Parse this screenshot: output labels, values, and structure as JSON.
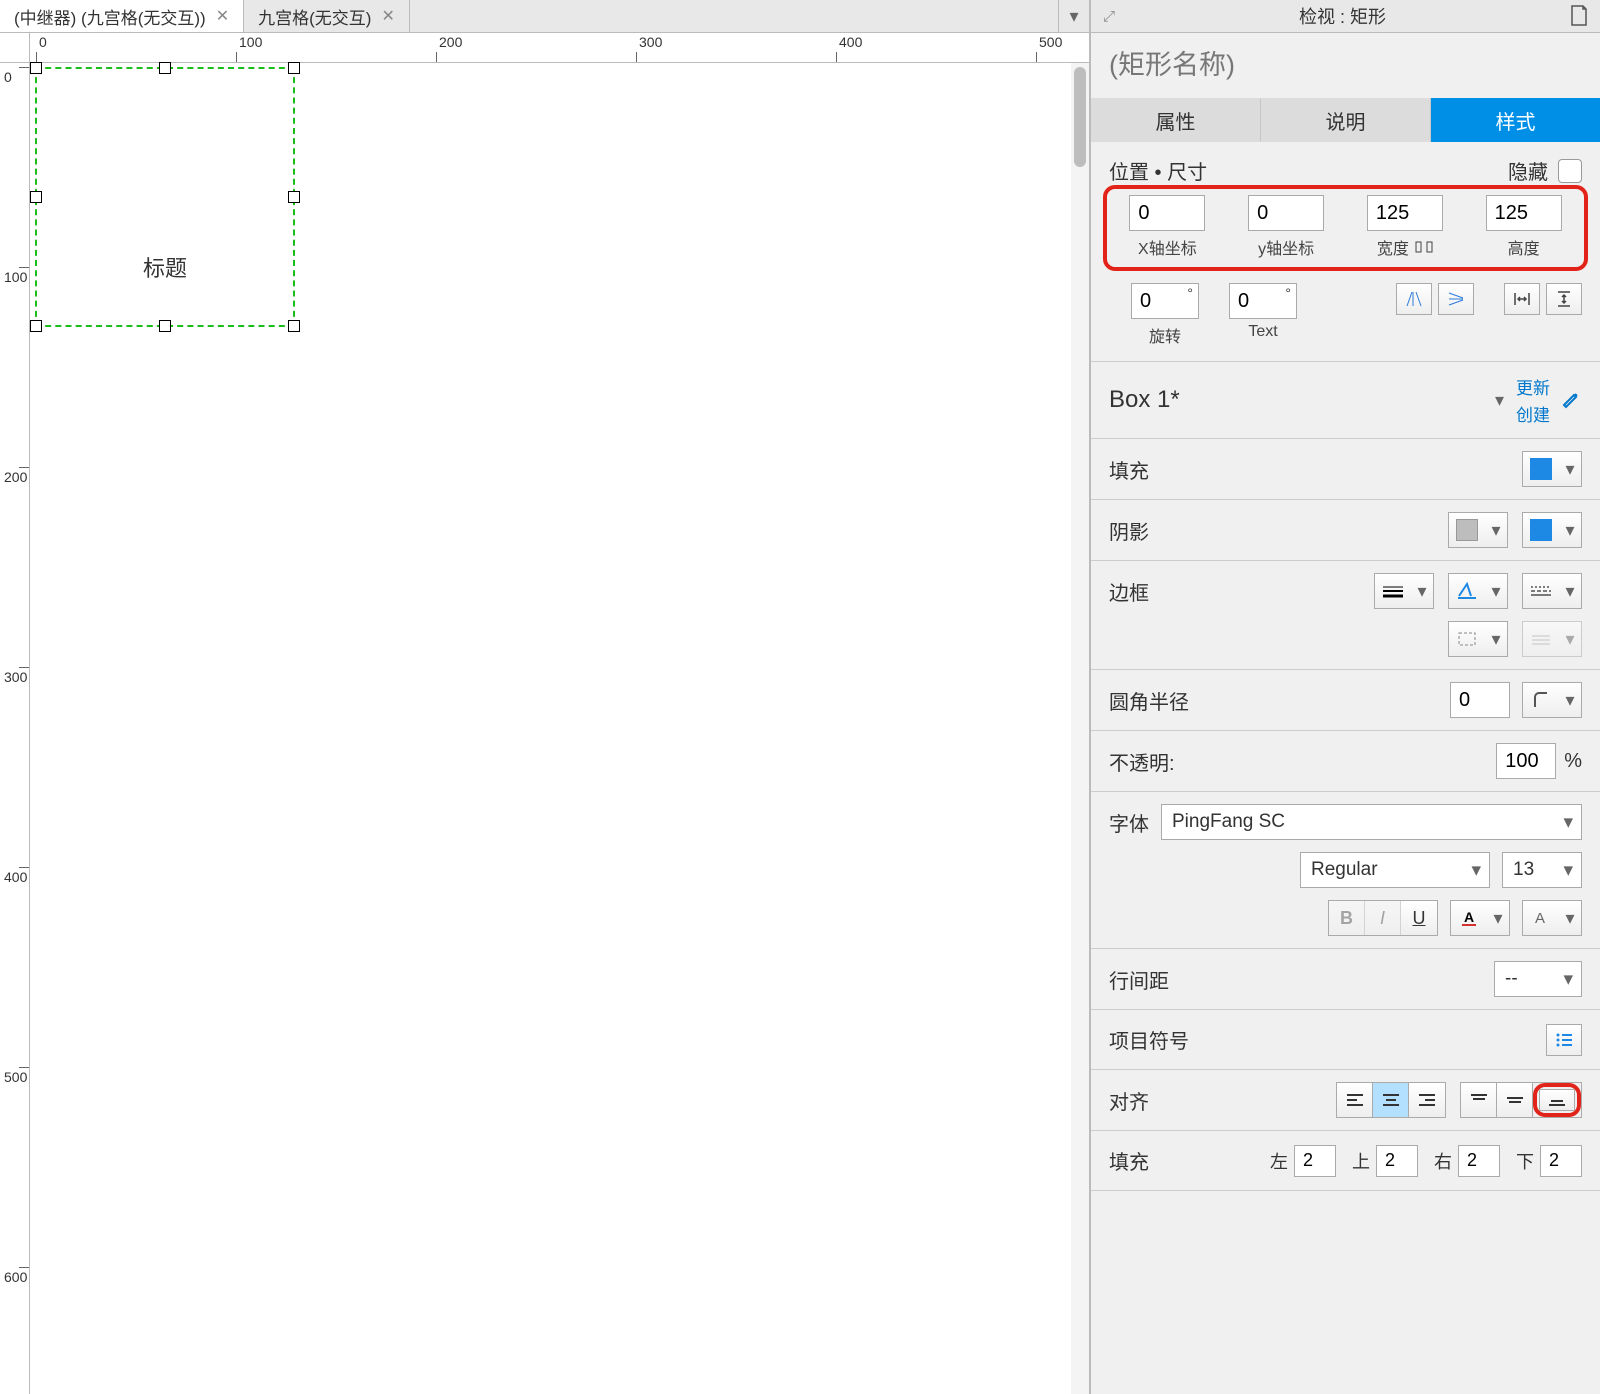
{
  "tabs": [
    {
      "label": "(中继器) (九宫格(无交互))",
      "active": true
    },
    {
      "label": "九宫格(无交互)",
      "active": false
    }
  ],
  "ruler_h": [
    "0",
    "100",
    "200",
    "300",
    "400",
    "500"
  ],
  "ruler_v": [
    "0",
    "100",
    "200",
    "300",
    "400",
    "500",
    "600"
  ],
  "canvas_shape_text": "标题",
  "inspector": {
    "header_title": "检视 : 矩形",
    "shape_name_placeholder": "(矩形名称)",
    "tabs": {
      "attr": "属性",
      "desc": "说明",
      "style": "样式"
    },
    "position": {
      "title": "位置 • 尺寸",
      "hide_label": "隐藏",
      "x": "0",
      "x_label": "X轴坐标",
      "y": "0",
      "y_label": "y轴坐标",
      "w": "125",
      "w_label": "宽度",
      "h": "125",
      "h_label": "高度",
      "rot": "0",
      "rot_label": "旋转",
      "text_rot": "0",
      "text_rot_label": "Text"
    },
    "style_name": "Box 1*",
    "links": {
      "update": "更新",
      "create": "创建"
    },
    "fill_label": "填充",
    "shadow_label": "阴影",
    "border_label": "边框",
    "corner_label": "圆角半径",
    "corner_value": "0",
    "opacity_label": "不透明:",
    "opacity_value": "100",
    "opacity_unit": "%",
    "font_label": "字体",
    "font_family": "PingFang SC",
    "font_weight": "Regular",
    "font_size": "13",
    "line_spacing_label": "行间距",
    "line_spacing_value": "--",
    "bullet_label": "项目符号",
    "align_label": "对齐",
    "padding": {
      "label": "填充",
      "l_label": "左",
      "l": "2",
      "t_label": "上",
      "t": "2",
      "r_label": "右",
      "r": "2",
      "b_label": "下",
      "b": "2"
    }
  }
}
